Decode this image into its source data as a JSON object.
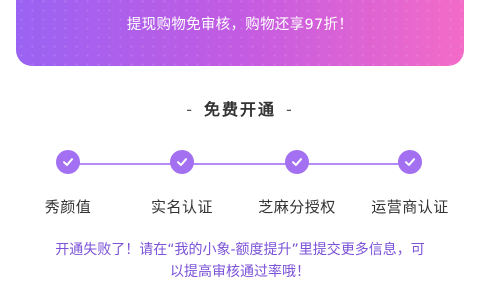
{
  "banner": {
    "text": "提现购物免审核，购物还享97折！"
  },
  "section": {
    "dash_left": "-",
    "title": "免费开通",
    "dash_right": "-"
  },
  "steps": [
    {
      "label": "秀颜值",
      "completed": true,
      "icon": "check-icon"
    },
    {
      "label": "实名认证",
      "completed": true,
      "icon": "check-icon"
    },
    {
      "label": "芝麻分授权",
      "completed": true,
      "icon": "check-icon"
    },
    {
      "label": "运营商认证",
      "completed": true,
      "icon": "check-icon"
    }
  ],
  "notice": {
    "line1": "开通失败了！请在“我的小象-额度提升”里提交更多信息，可",
    "line2": "以提高审核通过率哦！"
  },
  "colors": {
    "accent": "#a270f0",
    "notice": "#7b52d8",
    "banner_start": "#9a63f3",
    "banner_end": "#f36bc7"
  }
}
